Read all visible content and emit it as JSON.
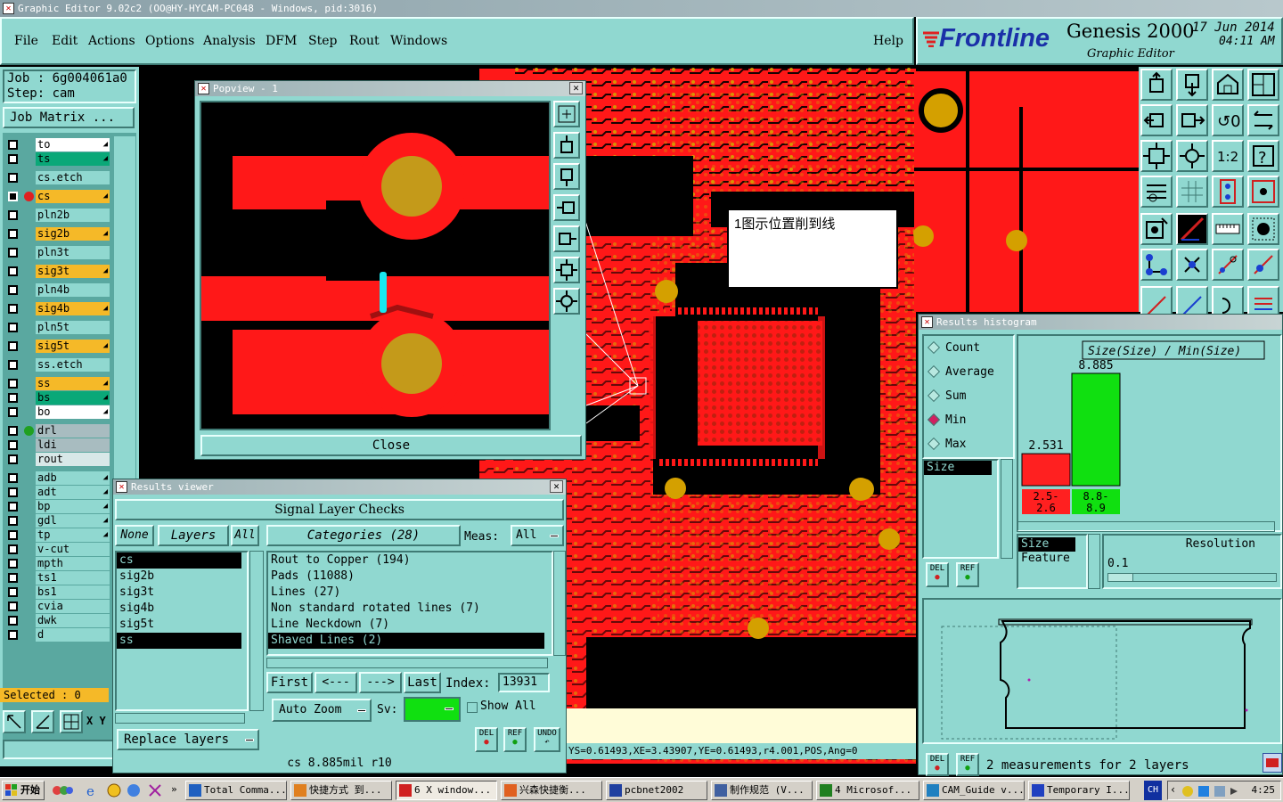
{
  "window_title": "Graphic Editor 9.02c2 (OO@HY-HYCAM-PC048 - Windows, pid:3016)",
  "menu": {
    "file": "File",
    "edit": "Edit",
    "actions": "Actions",
    "options": "Options",
    "analysis": "Analysis",
    "dfm": "DFM",
    "step": "Step",
    "rout": "Rout",
    "windows": "Windows",
    "help": "Help"
  },
  "brand": {
    "logo": "Frontline",
    "product": "Genesis 2000",
    "subtitle": "Graphic Editor",
    "date": "17 Jun 2014",
    "time": "04:11 AM"
  },
  "job": {
    "job_label": "Job : 6g004061a0",
    "step_label": "Step: cam",
    "matrix_button": "Job Matrix ..."
  },
  "layers": [
    {
      "name": "to",
      "color": "#ffffff",
      "arrow": true
    },
    {
      "name": "ts",
      "color": "#0aa878",
      "arrow": true
    },
    {
      "name": "cs.etch",
      "color": "#90d8d0",
      "arrow": false
    },
    {
      "name": "cs",
      "color": "#f5b928",
      "arrow": true,
      "active": true
    },
    {
      "name": "pln2b",
      "color": "#90d8d0",
      "arrow": false
    },
    {
      "name": "sig2b",
      "color": "#f5b928",
      "arrow": true
    },
    {
      "name": "pln3t",
      "color": "#90d8d0",
      "arrow": false
    },
    {
      "name": "sig3t",
      "color": "#f5b928",
      "arrow": true
    },
    {
      "name": "pln4b",
      "color": "#90d8d0",
      "arrow": false
    },
    {
      "name": "sig4b",
      "color": "#f5b928",
      "arrow": true
    },
    {
      "name": "pln5t",
      "color": "#90d8d0",
      "arrow": false
    },
    {
      "name": "sig5t",
      "color": "#f5b928",
      "arrow": true
    },
    {
      "name": "ss.etch",
      "color": "#90d8d0",
      "arrow": false
    },
    {
      "name": "ss",
      "color": "#f5b928",
      "arrow": true
    },
    {
      "name": "bs",
      "color": "#0aa878",
      "arrow": true
    },
    {
      "name": "bo",
      "color": "#ffffff",
      "arrow": true
    },
    {
      "name": "drl",
      "color": "#a8bcc0",
      "arrow": false,
      "dot": true
    },
    {
      "name": "ldi",
      "color": "#a8bcc0",
      "arrow": false
    },
    {
      "name": "rout",
      "color": "#d8e8e8",
      "arrow": false
    },
    {
      "name": "adb",
      "color": "#90d8d0",
      "arrow": true
    },
    {
      "name": "adt",
      "color": "#90d8d0",
      "arrow": true
    },
    {
      "name": "bp",
      "color": "#90d8d0",
      "arrow": true
    },
    {
      "name": "gdl",
      "color": "#90d8d0",
      "arrow": true
    },
    {
      "name": "tp",
      "color": "#90d8d0",
      "arrow": true
    },
    {
      "name": "v-cut",
      "color": "#90d8d0",
      "arrow": false
    },
    {
      "name": "mpth",
      "color": "#90d8d0",
      "arrow": false
    },
    {
      "name": "ts1",
      "color": "#90d8d0",
      "arrow": false
    },
    {
      "name": "bs1",
      "color": "#90d8d0",
      "arrow": false
    },
    {
      "name": "cvia",
      "color": "#90d8d0",
      "arrow": false
    },
    {
      "name": "dwk",
      "color": "#90d8d0",
      "arrow": false
    },
    {
      "name": "d",
      "color": "#90d8d0",
      "arrow": false
    }
  ],
  "selected_label": "Selected : 0",
  "xy_label": "X Y",
  "popview": {
    "title": "Popview - 1",
    "close": "Close"
  },
  "annotation": "1图示位置削到线",
  "results_viewer": {
    "title": "Results viewer",
    "header": "Signal Layer Checks",
    "none": "None",
    "layers_btn": "Layers",
    "all": "All",
    "categories_btn": "Categories (28)",
    "meas_label": "Meas:",
    "meas_value": "All",
    "layer_list": [
      "cs",
      "sig2b",
      "sig3t",
      "sig4b",
      "sig5t",
      "ss"
    ],
    "category_list": [
      "Rout to Copper (194)",
      "Pads (11088)",
      "Lines (27)",
      "Non standard rotated lines (7)",
      "Line Neckdown (7)",
      "Shaved Lines (2)"
    ],
    "first": "First",
    "prev": "<---",
    "next": "--->",
    "last": "Last",
    "index_label": "Index:",
    "index_value": "13931",
    "auto_zoom": "Auto Zoom",
    "sv_label": "Sv:",
    "show_all": "Show All",
    "replace_layers": "Replace layers",
    "del": "DEL",
    "ref": "REF",
    "undo": "UNDO",
    "status": "cs 8.885mil r10"
  },
  "histogram": {
    "title": "Results histogram",
    "stats": [
      "Count",
      "Average",
      "Sum",
      "Min",
      "Max"
    ],
    "selected_stat": "Min",
    "field": "Size",
    "chart_title": "Size(Size) / Min(Size)",
    "resolution_label": "Resolution",
    "resolution_value": "0.1",
    "list_a": "Size",
    "list_b": "Feature",
    "footer": "2 measurements for 2 layers",
    "chart_data": {
      "type": "bar",
      "categories": [
        "2.5-2.6",
        "8.8-8.9"
      ],
      "values": [
        2.531,
        8.885
      ],
      "colors": [
        "#ff2020",
        "#10e010"
      ]
    }
  },
  "coord_status": "YS=0.61493,XE=3.43907,YE=0.61493,r4.001,POS,Ang=0",
  "taskbar": {
    "start": "开始",
    "tasks": [
      "Total Comma...",
      "快捷方式 到...",
      "6 X window...",
      "兴森快捷衡...",
      "pcbnet2002",
      "制作规范 (V...",
      "4 Microsof...",
      "CAM_Guide v...",
      "Temporary I..."
    ],
    "lang": "CH",
    "clock": "4:25"
  }
}
